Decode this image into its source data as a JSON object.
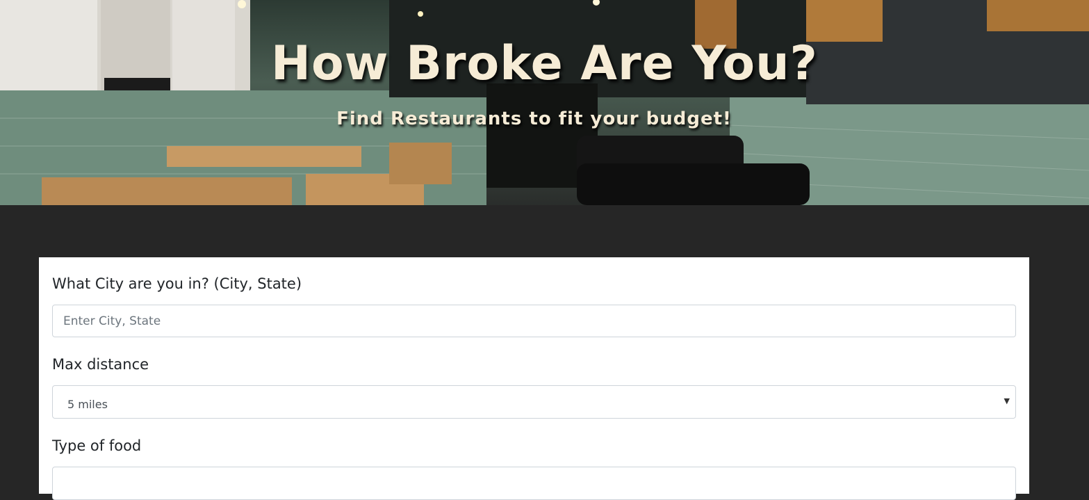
{
  "hero": {
    "title": "How Broke Are You?",
    "subtitle": "Find Restaurants to fit your budget!"
  },
  "form": {
    "city": {
      "label": "What City are you in? (City, State)",
      "placeholder": "Enter City, State"
    },
    "distance": {
      "label": "Max distance",
      "selected": "5 miles",
      "arrow_icon": "caret-down-icon"
    },
    "food": {
      "label": "Type of food"
    }
  },
  "colors": {
    "page_background": "#262626",
    "title_text": "#f6ecd6",
    "card_background": "#ffffff"
  }
}
